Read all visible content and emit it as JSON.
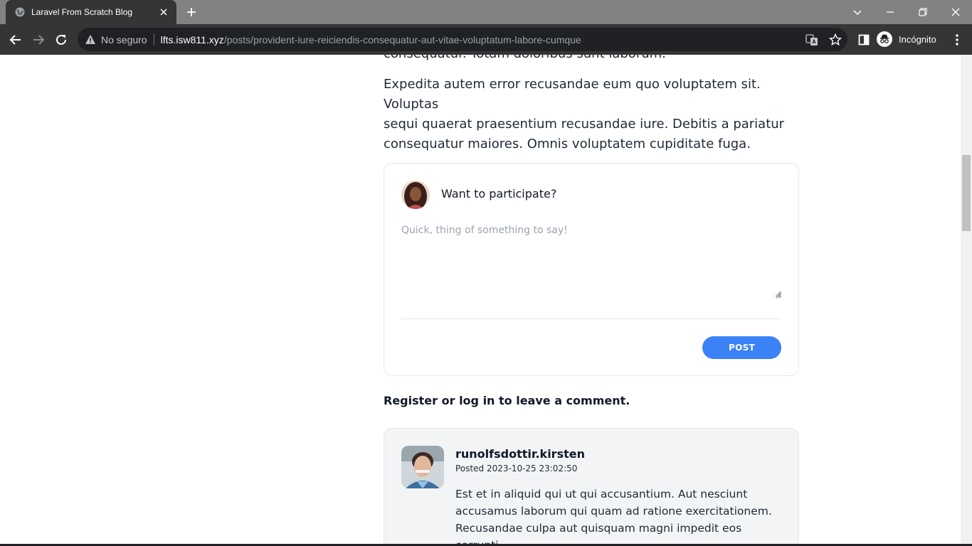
{
  "browser": {
    "tab_title": "Laravel From Scratch Blog",
    "security_label": "No seguro",
    "url_host": "lfts.isw811.xyz",
    "url_path": "/posts/provident-iure-reiciendis-consequatur-aut-vitae-voluptatum-labore-cumque",
    "profile_label": "Incógnito"
  },
  "article": {
    "partial_line": "consequatur. Totam doloribus sunt laborum.",
    "paragraph_lines": [
      "Expedita autem error recusandae eum quo voluptatem sit. Voluptas",
      "sequi quaerat praesentium recusandae iure. Debitis a pariatur",
      "consequatur maiores. Omnis voluptatem cupiditate fuga."
    ]
  },
  "comment_form": {
    "heading": "Want to participate?",
    "placeholder": "Quick, thing of something to say!",
    "value": "",
    "post_label": "POST"
  },
  "auth_prompt": {
    "register_label": "Register",
    "or_text": " or ",
    "login_label": "log in",
    "suffix": " to leave a comment."
  },
  "comments": [
    {
      "author": "runolfsdottir.kirsten",
      "posted_label": "Posted",
      "timestamp": "2023-10-25 23:02:50",
      "body_lines": [
        "Est et in aliquid qui ut qui accusantium. Aut nesciunt",
        "accusamus laborum qui quam ad ratione exercitationem.",
        "Recusandae culpa aut quisquam magni impedit eos corrupti."
      ]
    }
  ],
  "colors": {
    "accent": "#3b82f6",
    "chrome_dark": "#353535",
    "tabstrip": "#828282",
    "card_bg": "#f3f4f6"
  }
}
